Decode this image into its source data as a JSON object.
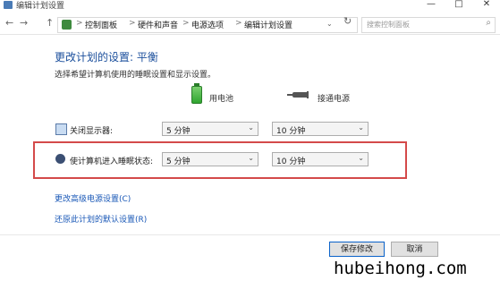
{
  "window": {
    "title": "编辑计划设置",
    "minimize": "—",
    "maximize": "□",
    "close": "✕"
  },
  "nav": {
    "back": "←",
    "forward": "→",
    "up": "↑"
  },
  "breadcrumbs": [
    "控制面板",
    "硬件和声音",
    "电源选项",
    "编辑计划设置"
  ],
  "breadcrumb_sep": ">",
  "address": {
    "refresh": "↻",
    "dropdown": "⌄"
  },
  "search": {
    "placeholder": "搜索控制面板",
    "icon": "search-icon"
  },
  "main": {
    "heading": "更改计划的设置: 平衡",
    "description": "选择希望计算机使用的睡眠设置和显示设置。",
    "col_battery": "用电池",
    "col_plugged": "接通电源"
  },
  "rows": [
    {
      "label": "关闭显示器:",
      "battery": "5 分钟",
      "plugged": "10 分钟"
    },
    {
      "label": "使计算机进入睡眠状态:",
      "battery": "5 分钟",
      "plugged": "10 分钟"
    }
  ],
  "links": {
    "advanced": "更改高级电源设置(C)",
    "restore": "还原此计划的默认设置(R)"
  },
  "buttons": {
    "save": "保存修改",
    "cancel": "取消"
  },
  "watermark": "hubeihong.com",
  "colors": {
    "accent": "#1b4f9c",
    "link": "#1a58b7",
    "highlight_border": "#d44a4a"
  }
}
